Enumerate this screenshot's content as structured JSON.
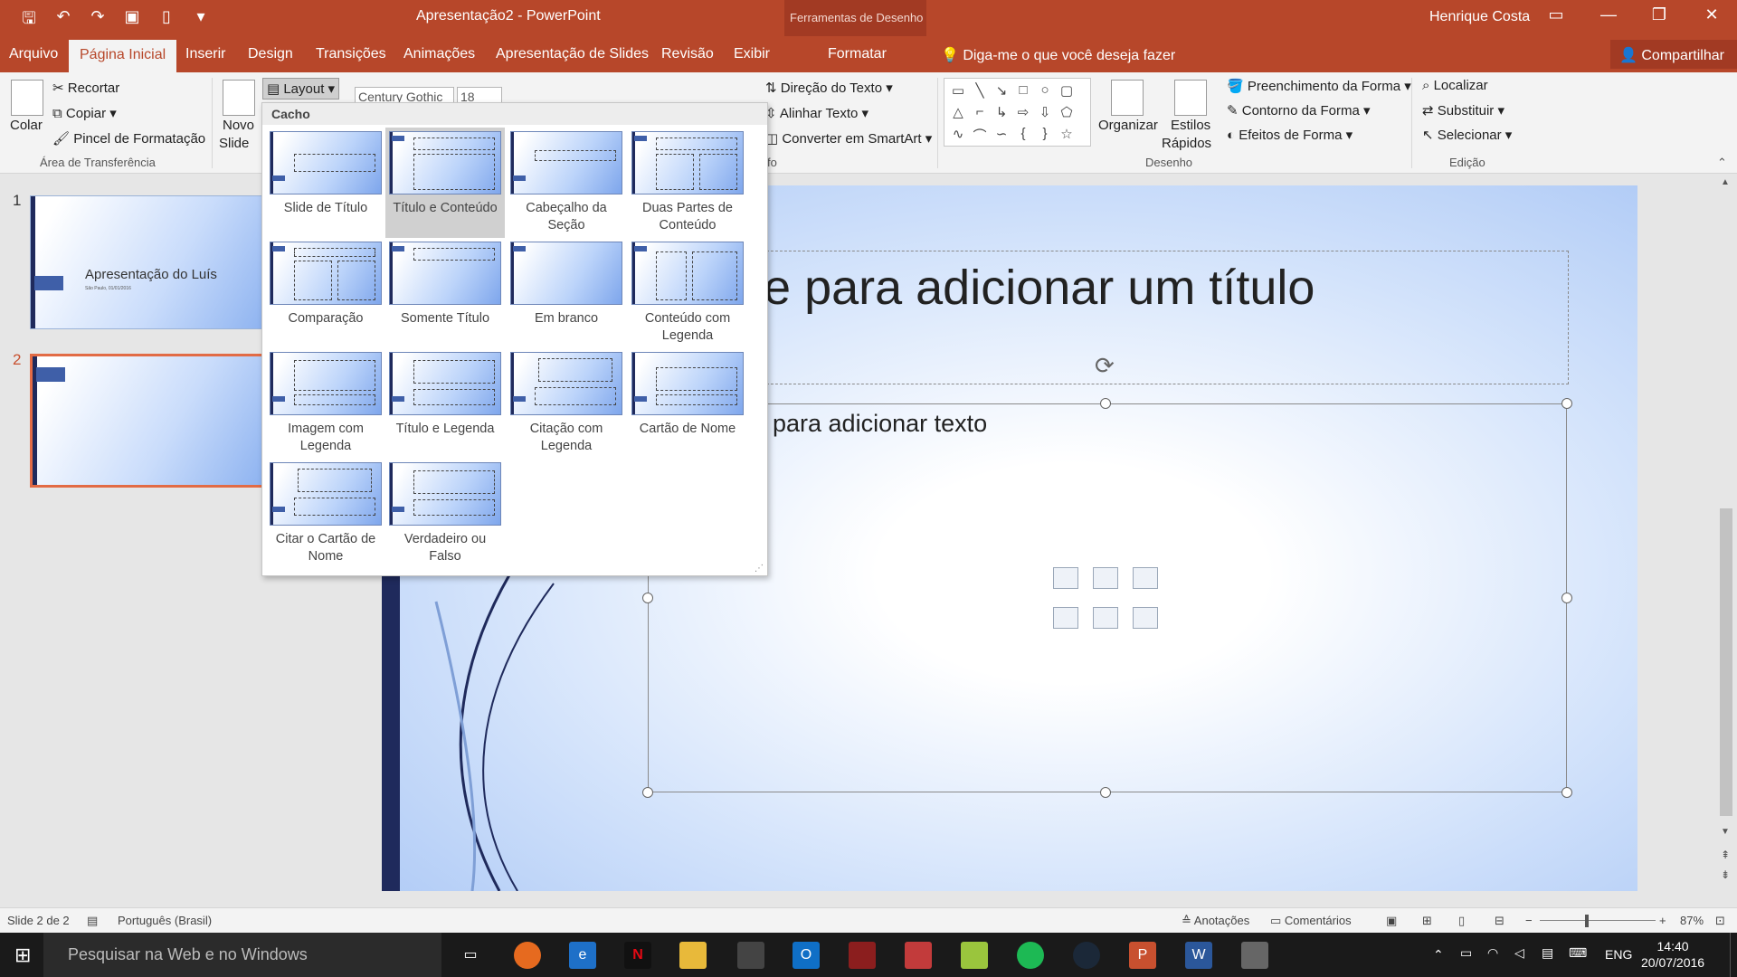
{
  "titlebar": {
    "doc_title": "Apresentação2 - PowerPoint",
    "tools_context": "Ferramentas de Desenho",
    "user": "Henrique Costa"
  },
  "tabs": {
    "file": "Arquivo",
    "home": "Página Inicial",
    "insert": "Inserir",
    "design": "Design",
    "transitions": "Transições",
    "animations": "Animações",
    "slideshow": "Apresentação de Slides",
    "review": "Revisão",
    "view": "Exibir",
    "format": "Formatar",
    "tell_me": "Diga-me o que você deseja fazer",
    "share": "Compartilhar"
  },
  "ribbon": {
    "paste": "Colar",
    "cut": "Recortar",
    "copy": "Copiar",
    "format_painter": "Pincel de Formatação",
    "clipboard_group": "Área de Transferência",
    "new_slide_1": "Novo",
    "new_slide_2": "Slide",
    "layout": "Layout",
    "font_name": "Century Gothic",
    "font_size": "18",
    "text_direction": "Direção do Texto",
    "align_text": "Alinhar Texto",
    "convert_smartart": "Converter em SmartArt",
    "paragraph_group_tail": "fo",
    "arrange": "Organizar",
    "quick_styles_1": "Estilos",
    "quick_styles_2": "Rápidos",
    "shape_fill": "Preenchimento da Forma",
    "shape_outline": "Contorno da Forma",
    "shape_effects": "Efeitos de Forma",
    "drawing_group": "Desenho",
    "find": "Localizar",
    "replace": "Substituir",
    "select": "Selecionar",
    "editing_group": "Edição"
  },
  "thumbnails": [
    {
      "number": "1",
      "title": "Apresentação do Luís",
      "subtitle": "São Paulo, 01/01/2016"
    },
    {
      "number": "2"
    }
  ],
  "slide": {
    "title_placeholder": "ue para adicionar um título",
    "content_placeholder": "para adicionar texto"
  },
  "layout_menu": {
    "header": "Cacho",
    "selected": "Título e Conteúdo",
    "items": [
      {
        "line1": "Slide de Título",
        "line2": ""
      },
      {
        "line1": "Título e Conteúdo",
        "line2": ""
      },
      {
        "line1": "Cabeçalho da",
        "line2": "Seção"
      },
      {
        "line1": "Duas Partes de",
        "line2": "Conteúdo"
      },
      {
        "line1": "Comparação",
        "line2": ""
      },
      {
        "line1": "Somente Título",
        "line2": ""
      },
      {
        "line1": "Em branco",
        "line2": ""
      },
      {
        "line1": "Conteúdo com",
        "line2": "Legenda"
      },
      {
        "line1": "Imagem com",
        "line2": "Legenda"
      },
      {
        "line1": "Título e Legenda",
        "line2": ""
      },
      {
        "line1": "Citação com",
        "line2": "Legenda"
      },
      {
        "line1": "Cartão de Nome",
        "line2": ""
      },
      {
        "line1": "Citar o Cartão de",
        "line2": "Nome"
      },
      {
        "line1": "Verdadeiro ou",
        "line2": "Falso"
      }
    ]
  },
  "statusbar": {
    "slide_info": "Slide 2 de 2",
    "language": "Português (Brasil)",
    "notes": "Anotações",
    "comments": "Comentários",
    "zoom": "87%"
  },
  "taskbar": {
    "search_placeholder": "Pesquisar na Web e no Windows",
    "lang": "ENG",
    "time": "14:40",
    "date": "20/07/2016"
  },
  "colors": {
    "accent": "#b7472a",
    "slide_bar": "#1f2a5c",
    "selection": "#e26b45"
  }
}
